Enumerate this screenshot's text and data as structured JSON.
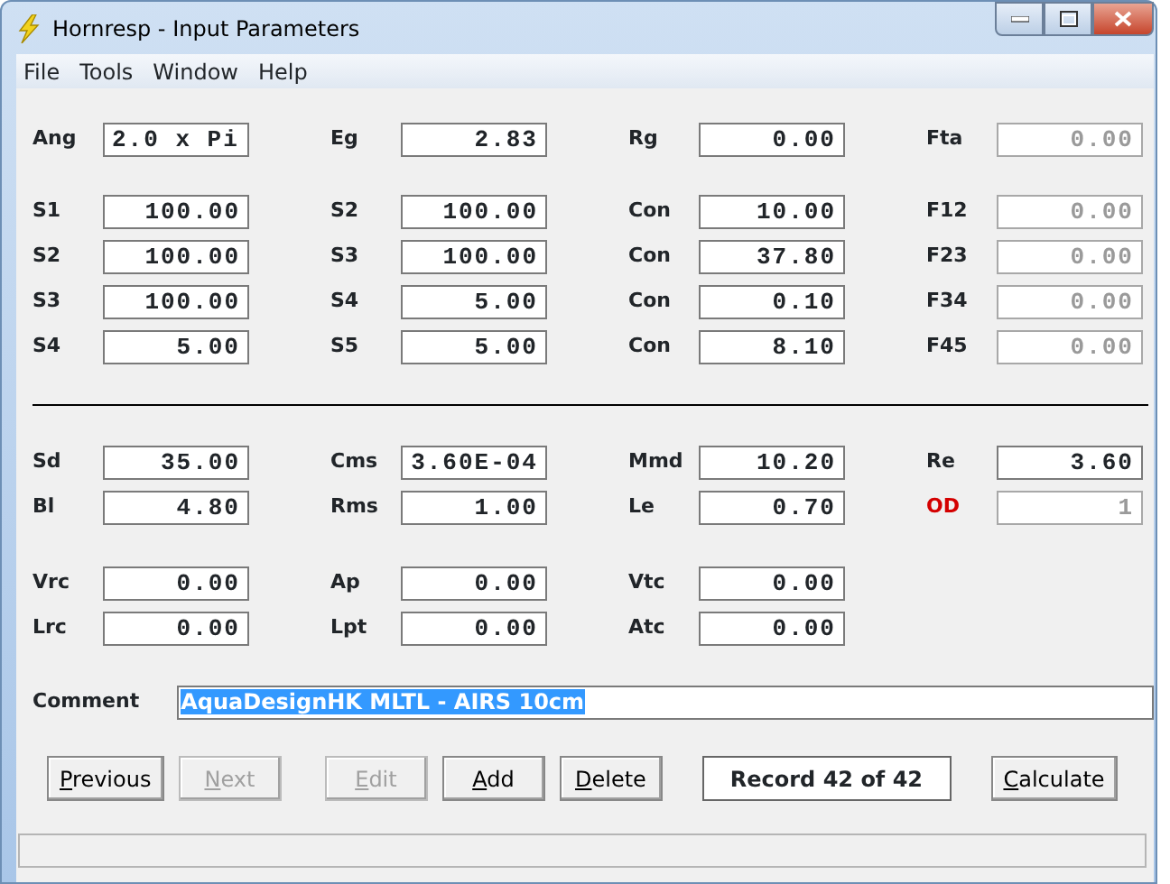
{
  "window": {
    "title": "Hornresp - Input Parameters"
  },
  "menu": [
    "File",
    "Tools",
    "Window",
    "Help"
  ],
  "sections": [
    [
      [
        {
          "label": "Ang",
          "value": "2.0 x Pi",
          "kind": "text",
          "disabled": false
        },
        {
          "label": "Eg",
          "value": "2.83",
          "kind": "number",
          "disabled": false
        },
        {
          "label": "Rg",
          "value": "0.00",
          "kind": "number",
          "disabled": false
        },
        {
          "label": "Fta",
          "value": "0.00",
          "kind": "number",
          "disabled": true
        }
      ]
    ],
    [
      [
        {
          "label": "S1",
          "value": "100.00",
          "kind": "number",
          "disabled": false
        },
        {
          "label": "S2",
          "value": "100.00",
          "kind": "number",
          "disabled": false
        },
        {
          "label": "Con",
          "value": "10.00",
          "kind": "number",
          "disabled": false
        },
        {
          "label": "F12",
          "value": "0.00",
          "kind": "number",
          "disabled": true
        }
      ],
      [
        {
          "label": "S2",
          "value": "100.00",
          "kind": "number",
          "disabled": false
        },
        {
          "label": "S3",
          "value": "100.00",
          "kind": "number",
          "disabled": false
        },
        {
          "label": "Con",
          "value": "37.80",
          "kind": "number",
          "disabled": false
        },
        {
          "label": "F23",
          "value": "0.00",
          "kind": "number",
          "disabled": true
        }
      ],
      [
        {
          "label": "S3",
          "value": "100.00",
          "kind": "number",
          "disabled": false
        },
        {
          "label": "S4",
          "value": "5.00",
          "kind": "number",
          "disabled": false
        },
        {
          "label": "Con",
          "value": "0.10",
          "kind": "number",
          "disabled": false
        },
        {
          "label": "F34",
          "value": "0.00",
          "kind": "number",
          "disabled": true
        }
      ],
      [
        {
          "label": "S4",
          "value": "5.00",
          "kind": "number",
          "disabled": false
        },
        {
          "label": "S5",
          "value": "5.00",
          "kind": "number",
          "disabled": false
        },
        {
          "label": "Con",
          "value": "8.10",
          "kind": "number",
          "disabled": false
        },
        {
          "label": "F45",
          "value": "0.00",
          "kind": "number",
          "disabled": true
        }
      ]
    ],
    [
      [
        {
          "label": "Sd",
          "value": "35.00",
          "kind": "number",
          "disabled": false
        },
        {
          "label": "Cms",
          "value": "3.60E-04",
          "kind": "number",
          "disabled": false
        },
        {
          "label": "Mmd",
          "value": "10.20",
          "kind": "number",
          "disabled": false
        },
        {
          "label": "Re",
          "value": "3.60",
          "kind": "number",
          "disabled": false
        }
      ],
      [
        {
          "label": "Bl",
          "value": "4.80",
          "kind": "number",
          "disabled": false
        },
        {
          "label": "Rms",
          "value": "1.00",
          "kind": "number",
          "disabled": false
        },
        {
          "label": "Le",
          "value": "0.70",
          "kind": "number",
          "disabled": false
        },
        {
          "label": "OD",
          "value": "1",
          "kind": "number",
          "disabled": true,
          "warning": true
        }
      ]
    ],
    [
      [
        {
          "label": "Vrc",
          "value": "0.00",
          "kind": "number",
          "disabled": false
        },
        {
          "label": "Ap",
          "value": "0.00",
          "kind": "number",
          "disabled": false
        },
        {
          "label": "Vtc",
          "value": "0.00",
          "kind": "number",
          "disabled": false
        }
      ],
      [
        {
          "label": "Lrc",
          "value": "0.00",
          "kind": "number",
          "disabled": false
        },
        {
          "label": "Lpt",
          "value": "0.00",
          "kind": "number",
          "disabled": false
        },
        {
          "label": "Atc",
          "value": "0.00",
          "kind": "number",
          "disabled": false
        }
      ]
    ]
  ],
  "comment": {
    "label": "Comment",
    "value": "AquaDesignHK MLTL - AIRS 10cm",
    "selected": true
  },
  "buttons": [
    {
      "kind": "button",
      "label": "Previous",
      "disabled": false
    },
    {
      "kind": "button",
      "label": "Next",
      "disabled": true
    },
    {
      "kind": "gap"
    },
    {
      "kind": "button",
      "label": "Edit",
      "disabled": true
    },
    {
      "kind": "button",
      "label": "Add",
      "disabled": false
    },
    {
      "kind": "button",
      "label": "Delete",
      "disabled": false
    },
    {
      "kind": "record",
      "label": "Record 42 of 42"
    },
    {
      "kind": "button",
      "label": "Calculate",
      "disabled": false
    }
  ]
}
